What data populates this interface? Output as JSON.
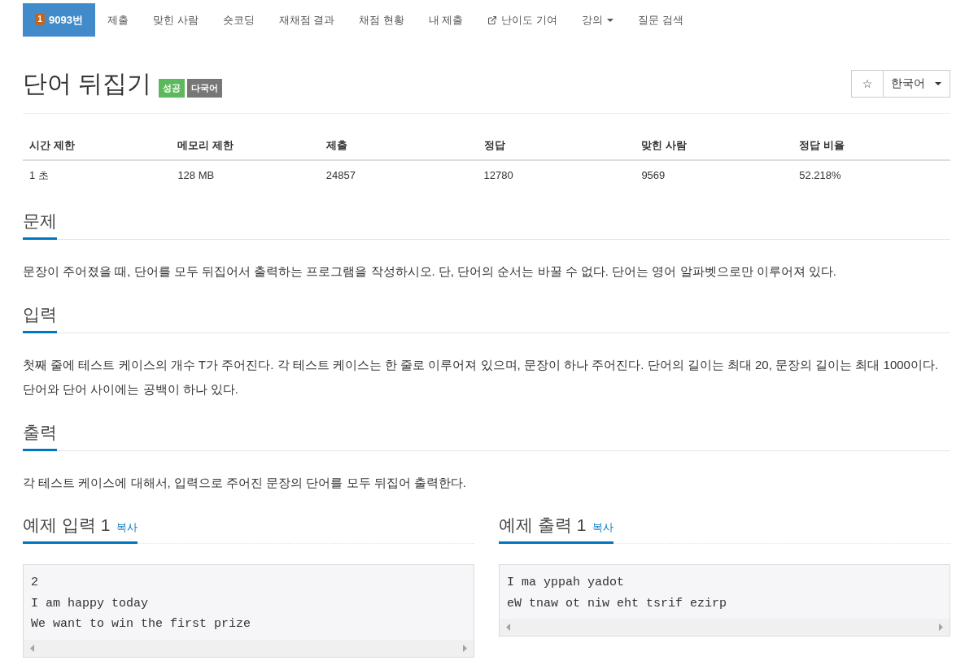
{
  "nav": {
    "tabs": [
      {
        "label": "9093번",
        "kind": "problem",
        "badge": "1",
        "selected": true
      },
      {
        "label": "제출",
        "kind": "link",
        "selected": false
      },
      {
        "label": "맞힌 사람",
        "kind": "link",
        "selected": false
      },
      {
        "label": "숏코딩",
        "kind": "link",
        "selected": false
      },
      {
        "label": "재채점 결과",
        "kind": "link",
        "selected": false
      },
      {
        "label": "채점 현황",
        "kind": "link",
        "selected": false
      },
      {
        "label": "내 제출",
        "kind": "link",
        "selected": false
      },
      {
        "label": "난이도 기여",
        "kind": "external",
        "selected": false
      },
      {
        "label": "강의",
        "kind": "dropdown",
        "selected": false
      },
      {
        "label": "질문 검색",
        "kind": "link",
        "selected": false
      }
    ]
  },
  "problem": {
    "title": "단어 뒤집기",
    "labels": [
      {
        "text": "성공",
        "color": "#5cb85c"
      },
      {
        "text": "다국어",
        "color": "#777777"
      }
    ],
    "star_button": "☆",
    "language_select": {
      "value": "한국어"
    }
  },
  "info_table": {
    "columns": [
      "시간 제한",
      "메모리 제한",
      "제출",
      "정답",
      "맞힌 사람",
      "정답 비율"
    ],
    "rows": [
      [
        "1 초",
        "128 MB",
        "24857",
        "12780",
        "9569",
        "52.218%"
      ]
    ]
  },
  "sections": [
    {
      "heading": "문제",
      "body": "문장이 주어졌을 때, 단어를 모두 뒤집어서 출력하는 프로그램을 작성하시오. 단, 단어의 순서는 바꿀 수 없다. 단어는 영어 알파벳으로만 이루어져 있다."
    },
    {
      "heading": "입력",
      "body": "첫째 줄에 테스트 케이스의 개수 T가 주어진다. 각 테스트 케이스는 한 줄로 이루어져 있으며, 문장이 하나 주어진다. 단어의 길이는 최대 20, 문장의 길이는 최대 1000이다. 단어와 단어 사이에는 공백이 하나 있다."
    },
    {
      "heading": "출력",
      "body": "각 테스트 케이스에 대해서, 입력으로 주어진 문장의 단어를 모두 뒤집어 출력한다."
    }
  ],
  "samples": [
    {
      "heading": "예제 입력 1",
      "copy_link": "복사",
      "lines": [
        "2",
        "I am happy today",
        "We want to win the first prize"
      ]
    },
    {
      "heading": "예제 출력 1",
      "copy_link": "복사",
      "lines": [
        "I ma yppah yadot",
        "eW tnaw ot niw eht tsrif ezirp"
      ]
    }
  ]
}
